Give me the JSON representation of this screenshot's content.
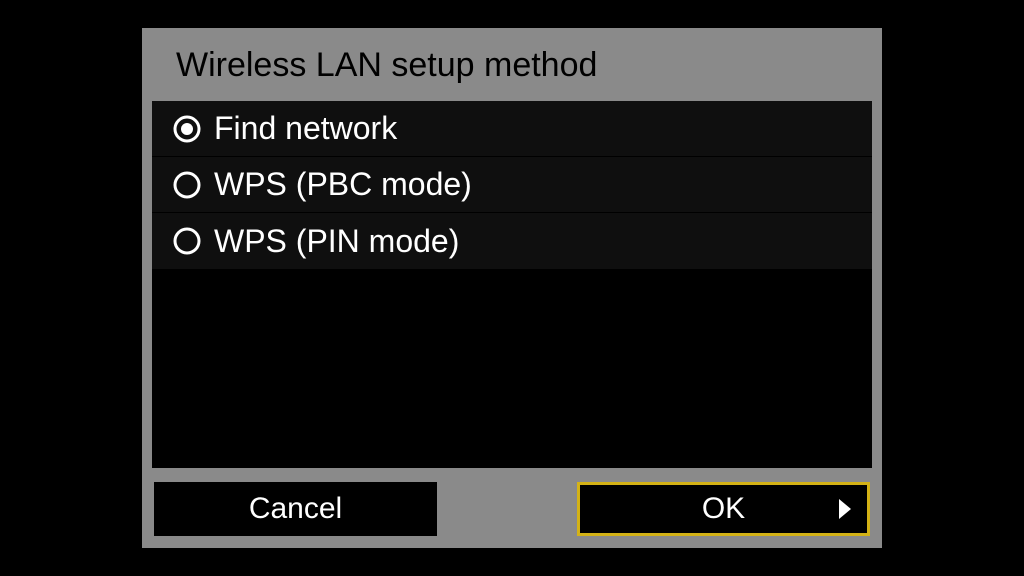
{
  "title": "Wireless LAN setup method",
  "options": [
    {
      "label": "Find network",
      "selected": true
    },
    {
      "label": "WPS (PBC mode)",
      "selected": false
    },
    {
      "label": "WPS (PIN mode)",
      "selected": false
    }
  ],
  "buttons": {
    "cancel": "Cancel",
    "ok": "OK"
  }
}
